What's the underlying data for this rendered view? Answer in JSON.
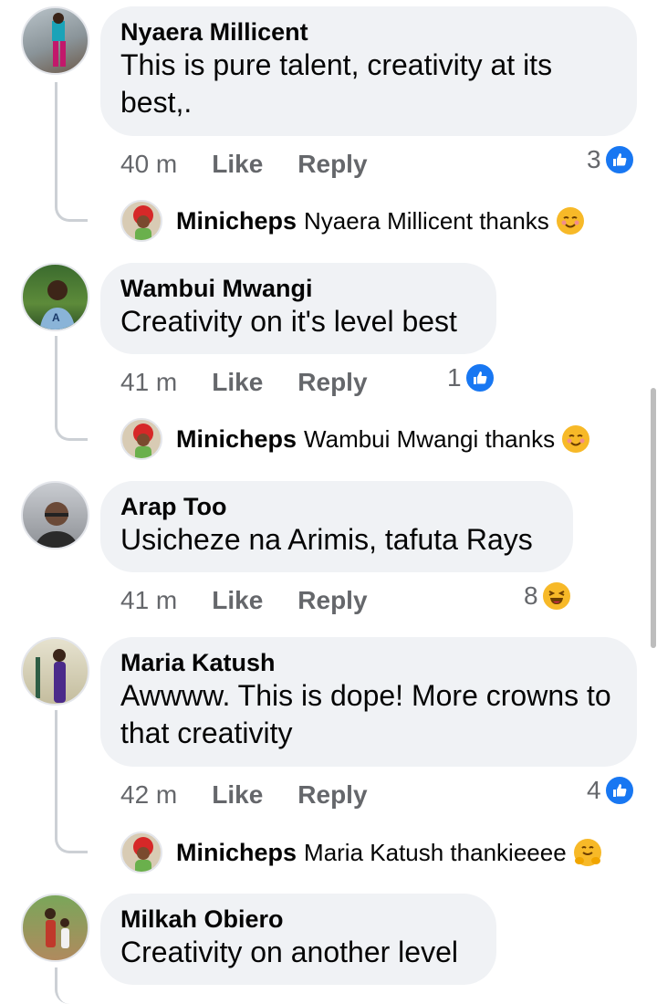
{
  "comments": [
    {
      "author": "Nyaera Millicent",
      "text": "This is pure talent, creativity at its best,.",
      "time": "40 m",
      "like_label": "Like",
      "reply_label": "Reply",
      "reaction_count": "3",
      "reaction_icon": "like-icon",
      "reply": {
        "author": "Minicheps",
        "text": "Nyaera Millicent thanks",
        "emoji": "smiling-blush-icon"
      }
    },
    {
      "author": "Wambui Mwangi",
      "text": "Creativity on it's level best",
      "time": "41 m",
      "like_label": "Like",
      "reply_label": "Reply",
      "reaction_count": "1",
      "reaction_icon": "like-icon",
      "reply": {
        "author": "Minicheps",
        "text": "Wambui Mwangi thanks",
        "emoji": "smiling-blush-icon"
      }
    },
    {
      "author": "Arap Too",
      "text": "Usicheze na Arimis, tafuta Rays",
      "time": "41 m",
      "like_label": "Like",
      "reply_label": "Reply",
      "reaction_count": "8",
      "reaction_icon": "haha-icon"
    },
    {
      "author": "Maria Katush",
      "text": "Awwww. This is dope! More crowns to that creativity",
      "time": "42 m",
      "like_label": "Like",
      "reply_label": "Reply",
      "reaction_count": "4",
      "reaction_icon": "like-icon",
      "reply": {
        "author": "Minicheps",
        "text": "Maria Katush thankieeee",
        "emoji": "hugging-face-icon"
      }
    },
    {
      "author": "Milkah Obiero",
      "text": "Creativity on another level"
    }
  ],
  "colors": {
    "accent": "#1877f2",
    "bubble": "#f0f2f5",
    "meta": "#65676b",
    "reaction_yellow": "#f7b928"
  }
}
